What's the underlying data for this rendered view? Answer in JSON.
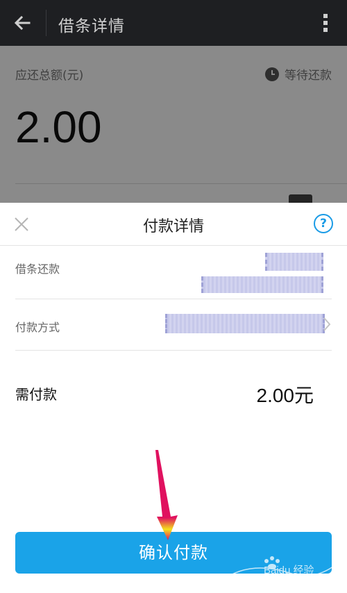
{
  "appbar": {
    "title": "借条详情"
  },
  "background_page": {
    "total_label": "应还总额(元)",
    "status": "等待还款",
    "amount": "2.00"
  },
  "sheet": {
    "title": "付款详情",
    "help_label": "?",
    "rows": [
      {
        "label": "借条还款"
      },
      {
        "label": "付款方式"
      }
    ],
    "total": {
      "label": "需付款",
      "value": "2.00元"
    },
    "confirm_label": "确认付款"
  },
  "watermark": {
    "text": "Baidu 经验"
  },
  "colors": {
    "accent": "#1aa3e8",
    "appbar": "#1e1f22",
    "arrow": "#e0115f"
  },
  "icons": [
    "back-arrow-icon",
    "more-vert-icon",
    "clock-icon",
    "close-icon",
    "help-icon",
    "chevron-right-icon",
    "pointer-arrow-icon"
  ]
}
